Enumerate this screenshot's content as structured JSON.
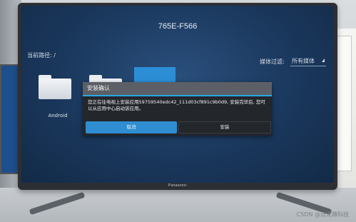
{
  "screen": {
    "device_title": "765E-F566",
    "current_path": "当前路径: /",
    "media_filter_label": "媒体过滤:",
    "media_filter_value": "所有媒体",
    "folders": [
      {
        "label": "Android"
      },
      {
        "label": ""
      }
    ]
  },
  "dialog": {
    "title": "安装确认",
    "message": "您正在往电视上安装应用59759540edc42_111d03cf891c9b0d9, 安装完毕后, 您可以从应用中心启动该应用。",
    "cancel_label": "取消",
    "install_label": "安装"
  },
  "tv": {
    "brand": "Panasonic"
  },
  "watermark": "CSDN @云龙蹲科技",
  "colors": {
    "screen_bg": "#1a375c",
    "accent": "#2aa6e6",
    "focused_button": "#2f8ed1",
    "dialog_bg": "#23262b"
  }
}
